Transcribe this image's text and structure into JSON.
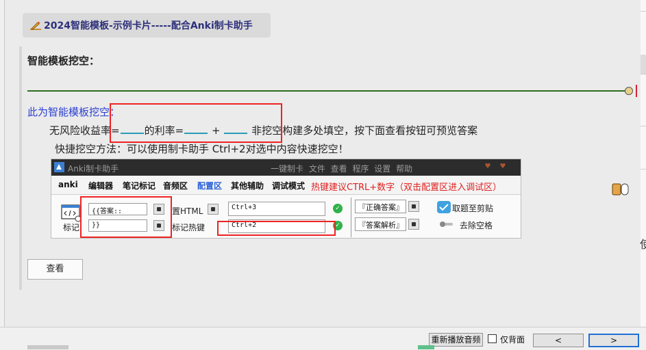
{
  "card": {
    "title": "2024智能模板-示例卡片-----配合Anki制卡助手",
    "section_heading": "智能模板挖空：",
    "intro": "此为智能模板挖空：",
    "question": {
      "part1": "无风险收益率=",
      "part2": "的利率=",
      "part3": "+",
      "part4": "非挖空构建多处填空，按下面查看按钮可预览答案"
    },
    "tip": "快捷挖空方法：可以使用制卡助手 Ctrl+2对选中内容快速挖空！",
    "view_button": "查看"
  },
  "helper_window": {
    "title": "Anki制卡助手",
    "menu": "一键制卡 文件 查看 程序 设置 帮助",
    "tabs": [
      "anki",
      "编辑器",
      "笔记标记",
      "音频区",
      "配置区",
      "其他辅助",
      "调试模式"
    ],
    "active_tab": "配置区",
    "hotkey_hint": "热键建议CTRL+数字（双击配置区进入调试区）",
    "label_mark": "标记",
    "open_field": "{{答案::",
    "close_field": "}}",
    "label_html": "置HTML",
    "label_hotkey": "标记热键",
    "hotkey1": "Ctrl+3",
    "hotkey2": "Ctrl+2",
    "answer_correct": "『正确答案』",
    "answer_analysis": "『答案解析』",
    "option_clipboard": "取题至剪贴",
    "option_trim": "去除空格"
  },
  "bottom": {
    "replay_audio": "重新播放音频",
    "back_only": "仅背面",
    "prev": "<",
    "next": ">"
  },
  "edge_glyph": "使",
  "colors": {
    "title_text": "#2d2f7a",
    "intro_blue": "#2a3ed0",
    "divider_green": "#2e6e1e",
    "highlight_red": "#e22222",
    "blank_underline": "#2a9bb8",
    "active_tab_blue": "#2a62d8"
  }
}
